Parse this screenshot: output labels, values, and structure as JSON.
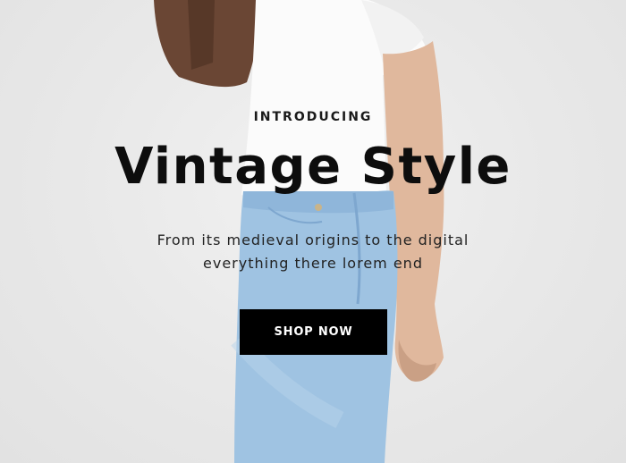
{
  "hero": {
    "eyebrow": "INTRODUCING",
    "title": "Vintage Style",
    "description": "From its medieval origins to the digital everything there lorem end",
    "cta_label": "SHOP NOW"
  },
  "colors": {
    "background": "#e9e9e9",
    "button_bg": "#000000",
    "button_text": "#ffffff",
    "text_dark": "#0d0d0d"
  }
}
